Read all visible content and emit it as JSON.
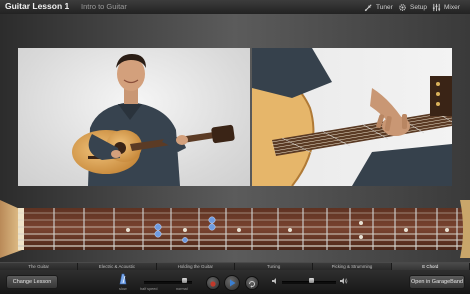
{
  "titlebar": {
    "title": "Guitar Lesson 1",
    "subtitle": "Intro to Guitar",
    "buttons": [
      {
        "label": "Tuner",
        "icon": "tuner-icon"
      },
      {
        "label": "Setup",
        "icon": "gear-icon"
      },
      {
        "label": "Mixer",
        "icon": "mixer-icon"
      }
    ]
  },
  "tabs": [
    {
      "label": "The Guitar",
      "active": false
    },
    {
      "label": "Electric & Acoustic",
      "active": false
    },
    {
      "label": "Holding the Guitar",
      "active": false
    },
    {
      "label": "Tuning",
      "active": false
    },
    {
      "label": "Picking & Strumming",
      "active": false
    },
    {
      "label": "E Chord",
      "active": true
    }
  ],
  "controls": {
    "change_lesson": "Change Lesson",
    "open_garageband": "Open in GarageBand",
    "speed_left": "slow",
    "speed_mid": "half speed",
    "speed_right": "normal",
    "speed_level": 0.85,
    "volume_level": 0.55
  },
  "colors": {
    "record": "#c0392b",
    "play": "#3b7fd1",
    "fretboard": "#6b3a2a",
    "note_dot": "#6f9be0"
  }
}
